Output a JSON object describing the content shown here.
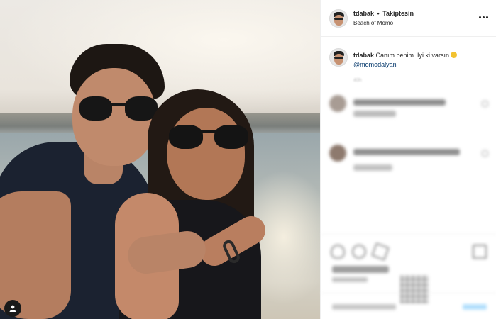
{
  "post": {
    "username": "tdabak",
    "separator": "•",
    "follow_status": "Takiptesin",
    "location": "Beach of Momo",
    "more_icon": "more-horizontal-icon"
  },
  "caption": {
    "username": "tdabak",
    "text": "Canım benim..İyi ki varsın",
    "emoji_icon": "smiling-face-icon",
    "mention": "@momodalyan",
    "time": "40h"
  },
  "photo": {
    "badge_icon": "user-tag-icon"
  },
  "colors": {
    "link": "#003569",
    "text": "#262626",
    "divider": "#efefef"
  }
}
